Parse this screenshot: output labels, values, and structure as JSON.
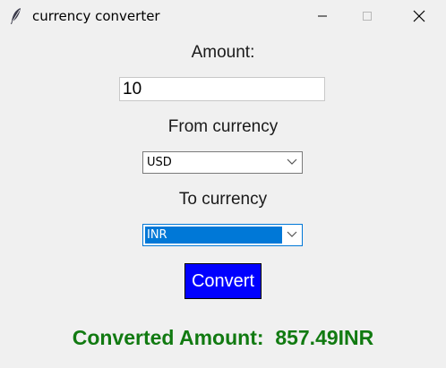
{
  "window": {
    "title": "currency converter",
    "icon": "feather-icon"
  },
  "form": {
    "amount_label": "Amount:",
    "amount_value": "10",
    "from_label": "From currency",
    "from_value": "USD",
    "to_label": "To currency",
    "to_value": "INR",
    "convert_label": "Convert"
  },
  "result": {
    "label": "Converted Amount:",
    "value": "857.49INR"
  },
  "colors": {
    "convert_button": "#0000ff",
    "result_text": "#117a11",
    "selection_highlight": "#0078d7"
  }
}
